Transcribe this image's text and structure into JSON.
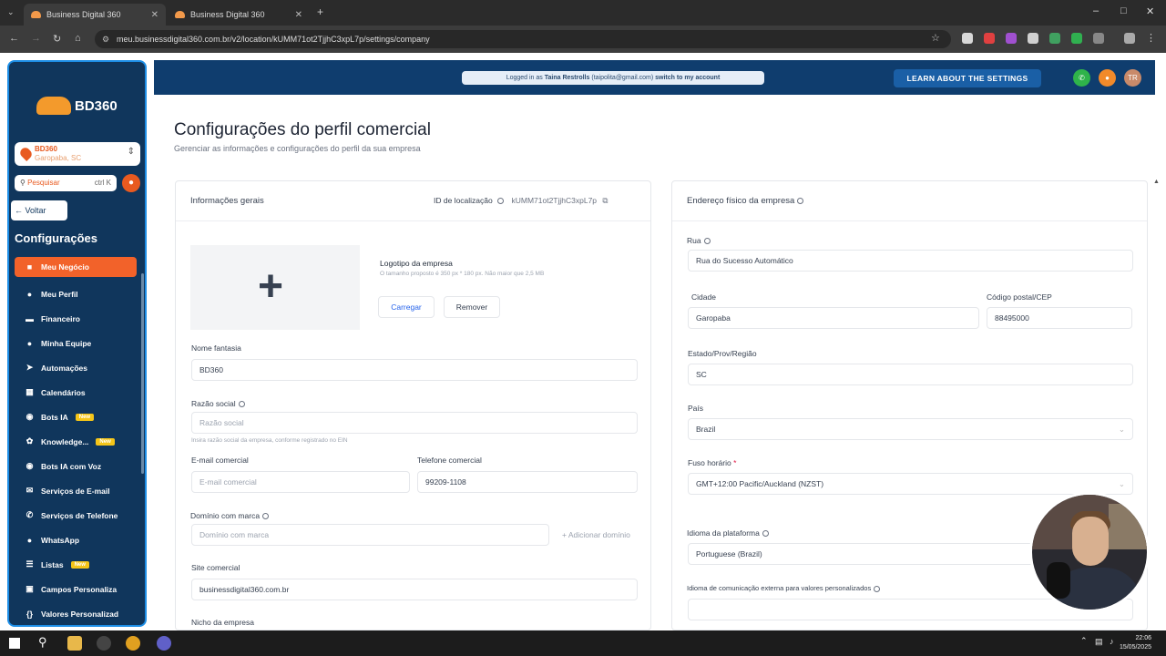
{
  "browser": {
    "tabs": [
      {
        "title": "Business Digital 360"
      },
      {
        "title": "Business Digital 360"
      }
    ],
    "new_tab": "+",
    "url": "meu.businessdigital360.com.br/v2/location/kUMM71ot2TjjhC3xpL7p/settings/company"
  },
  "sidebar": {
    "brand": "BD360",
    "location_name": "BD360",
    "location_city": "Garopaba, SC",
    "search_placeholder": "Pesquisar",
    "search_shortcut": "ctrl K",
    "back_label": "Voltar",
    "section_title": "Configurações",
    "items": [
      {
        "label": "Meu Negócio",
        "icon": "briefcase-icon",
        "badge": ""
      },
      {
        "label": "Meu Perfil",
        "icon": "user-icon",
        "badge": ""
      },
      {
        "label": "Financeiro",
        "icon": "finance-icon",
        "badge": ""
      },
      {
        "label": "Minha Equipe",
        "icon": "team-icon",
        "badge": ""
      },
      {
        "label": "Automações",
        "icon": "rocket-icon",
        "badge": ""
      },
      {
        "label": "Calendários",
        "icon": "calendar-icon",
        "badge": ""
      },
      {
        "label": "Bots IA",
        "icon": "bot-icon",
        "badge": "New"
      },
      {
        "label": "Knowledge...",
        "icon": "brain-icon",
        "badge": "New"
      },
      {
        "label": "Bots IA com Voz",
        "icon": "voice-bot-icon",
        "badge": ""
      },
      {
        "label": "Serviços de E-mail",
        "icon": "email-icon",
        "badge": ""
      },
      {
        "label": "Serviços de Telefone",
        "icon": "phone-icon",
        "badge": ""
      },
      {
        "label": "WhatsApp",
        "icon": "whatsapp-icon",
        "badge": ""
      },
      {
        "label": "Listas",
        "icon": "list-icon",
        "badge": "New"
      },
      {
        "label": "Campos Personaliza",
        "icon": "fields-icon",
        "badge": ""
      },
      {
        "label": "Valores Personalizad",
        "icon": "braces-icon",
        "badge": ""
      }
    ]
  },
  "banner": {
    "logged_in_prefix": "Logged in as",
    "logged_in_user": "Taina Restrolls",
    "logged_in_email": "(taipolita@gmail.com)",
    "switch_label": "switch to my account",
    "learn_button": "LEARN ABOUT THE SETTINGS",
    "avatar_initials": "TR"
  },
  "main": {
    "title": "Configurações do perfil comercial",
    "subtitle": "Gerenciar as informações e configurações do perfil da sua empresa"
  },
  "general": {
    "title": "Informações gerais",
    "location_id_label": "ID de localização",
    "location_id": "kUMM71ot2TjjhC3xpL7p",
    "logo_title": "Logotipo da empresa",
    "logo_hint": "O tamanho proposto é 350 px * 180 px. Não maior que 2,5 MB",
    "upload_button": "Carregar",
    "remove_button": "Remover",
    "trade_name_label": "Nome fantasia",
    "trade_name_value": "BD360",
    "legal_name_label": "Razão social",
    "legal_name_placeholder": "Razão social",
    "legal_name_hint": "Insira razão social da empresa, conforme registrado no EIN",
    "email_label": "E-mail comercial",
    "email_placeholder": "E-mail comercial",
    "phone_label": "Telefone comercial",
    "phone_value": "99209-1108",
    "domain_label": "Domínio com marca",
    "domain_placeholder": "Domínio com marca",
    "add_domain_button": "+ Adicionar domínio",
    "site_label": "Site comercial",
    "site_value": "businessdigital360.com.br",
    "niche_label": "Nicho da empresa"
  },
  "address": {
    "title": "Endereço físico da empresa",
    "street_label": "Rua",
    "street_value": "Rua do Sucesso Automático",
    "city_label": "Cidade",
    "city_value": "Garopaba",
    "zip_label": "Código postal/CEP",
    "zip_value": "88495000",
    "state_label": "Estado/Prov/Região",
    "state_value": "SC",
    "country_label": "País",
    "country_value": "Brazil",
    "timezone_label": "Fuso horário",
    "timezone_required": "*",
    "timezone_value": "GMT+12:00 Pacific/Auckland (NZST)",
    "language_label": "Idioma da plataforma",
    "language_value": "Portuguese (Brazil)",
    "ext_language_label": "Idioma de comunicação externa para valores personalizados"
  },
  "taskbar": {
    "time": "22:06",
    "date": "15/05/2025"
  },
  "colors": {
    "sidebar_bg": "#10365c",
    "accent_orange": "#f2622a",
    "banner_bg": "#0f3d6e",
    "learn_button_bg": "#1a5fa6"
  }
}
